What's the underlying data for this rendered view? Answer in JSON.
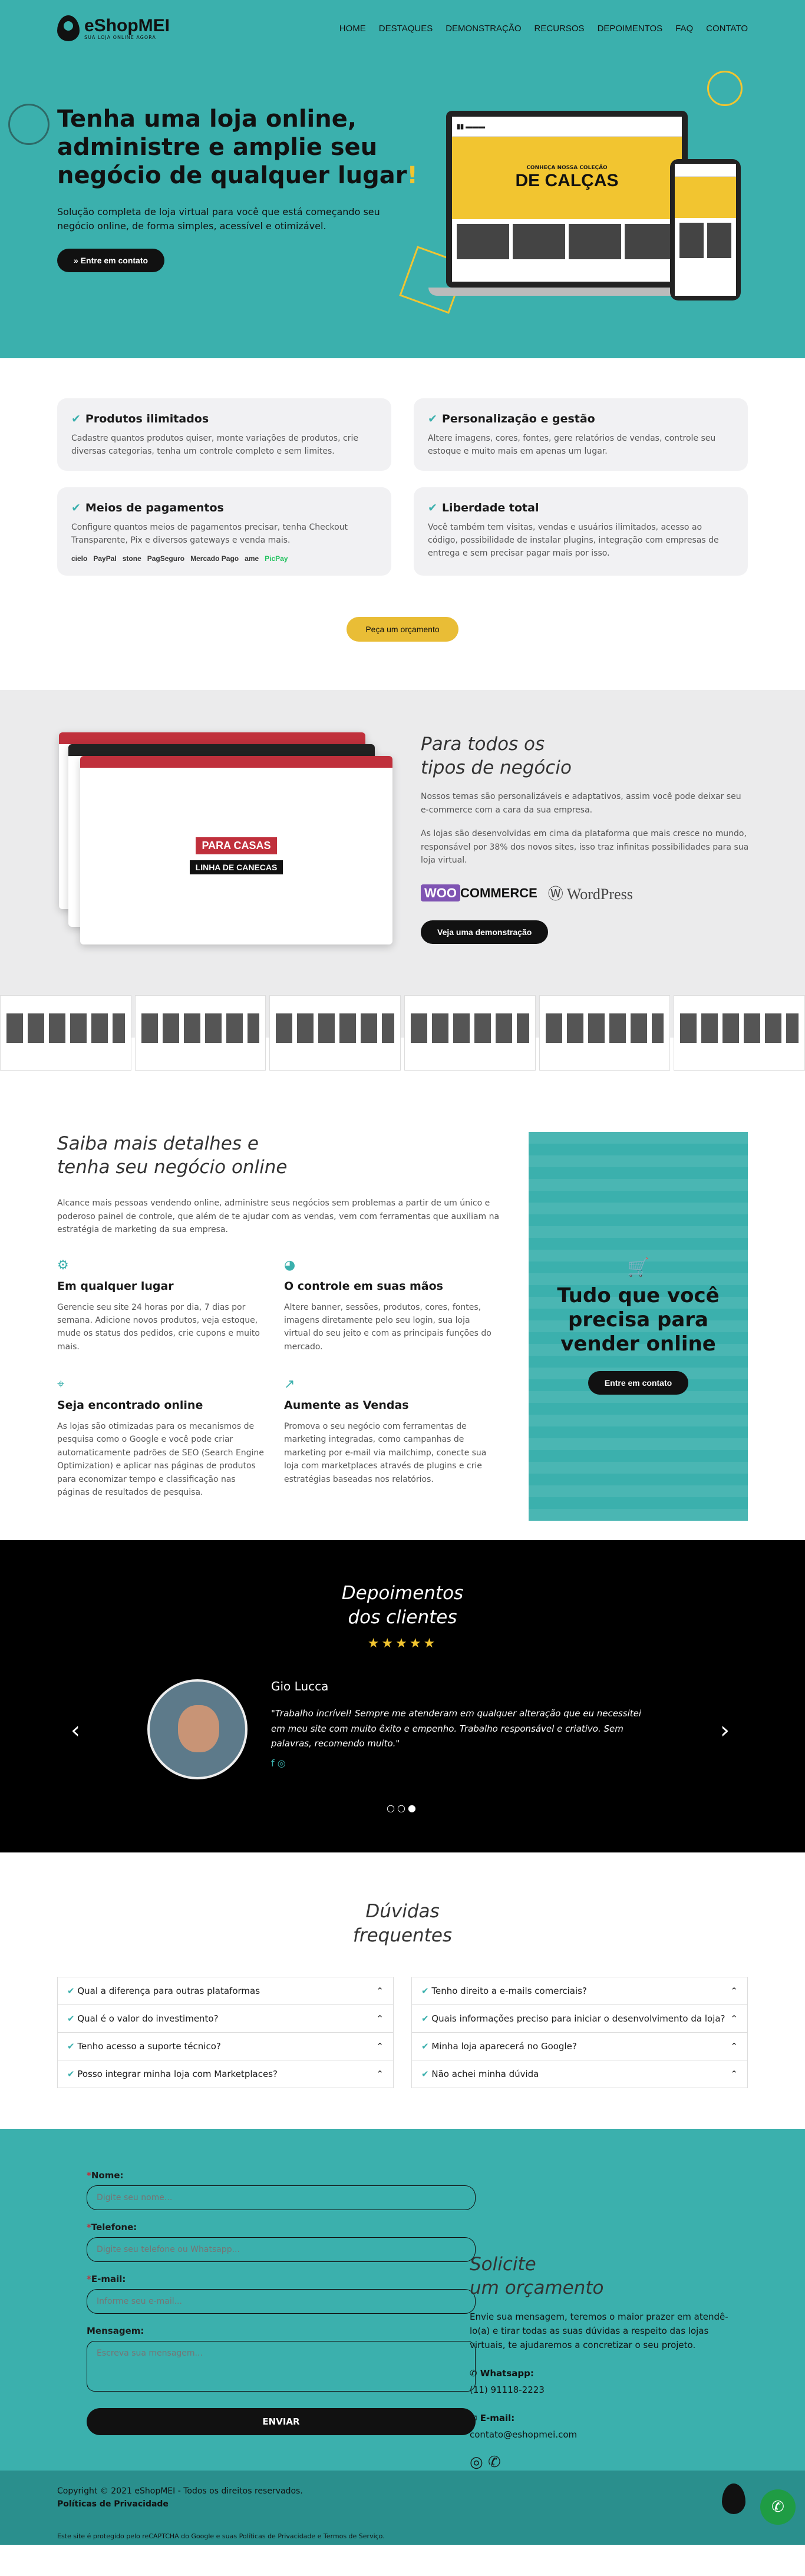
{
  "brand": {
    "name": "eShopMEI",
    "tagline": "SUA LOJA ONLINE AGORA"
  },
  "nav": [
    "HOME",
    "DESTAQUES",
    "DEMONSTRAÇÃO",
    "RECURSOS",
    "DEPOIMENTOS",
    "FAQ",
    "CONTATO"
  ],
  "hero": {
    "title": "Tenha uma loja online, administre e amplie seu negócio de qualquer lugar",
    "title_mark": "!",
    "subtitle": "Solução completa de loja virtual para você que está começando seu negócio online, de forma simples, acessível e otimizável.",
    "cta": "Entre em contato",
    "mock_banner_small": "CONHEÇA NOSSA COLEÇÃO",
    "mock_banner_big": "DE CALÇAS"
  },
  "features": [
    {
      "title": "Produtos ilimitados",
      "text": "Cadastre quantos produtos quiser, monte variações de produtos, crie diversas categorias, tenha um controle completo e sem limites."
    },
    {
      "title": "Personalização e gestão",
      "text": "Altere imagens, cores, fontes, gere relatórios de vendas, controle seu estoque e muito mais em apenas um lugar."
    },
    {
      "title": "Meios de pagamentos",
      "text": "Configure quantos meios de pagamentos precisar, tenha Checkout Transparente, Pix e diversos gateways e venda mais."
    },
    {
      "title": "Liberdade total",
      "text": "Você também tem visitas, vendas e usuários ilimitados, acesso ao código, possibilidade de instalar plugins, integração com empresas de entrega e sem precisar pagar mais por isso."
    }
  ],
  "payments": [
    "cielo",
    "PayPal",
    "stone",
    "PagSeguro",
    "Mercado Pago",
    "ame",
    "PicPay"
  ],
  "quote_button": "Peça um orçamento",
  "templates": {
    "title_1": "Para todos os",
    "title_2": "tipos de negócio",
    "p1": "Nossos temas são personalizáveis e adaptativos, assim você pode deixar seu e-commerce com a cara da sua empresa.",
    "p2": "As lojas são desenvolvidas em cima da plataforma que mais cresce no mundo, responsável por 38% dos novos sites, isso traz infinitas possibilidades para sua loja virtual.",
    "woo_1": "WOO",
    "woo_2": "COMMERCE",
    "wp": "WordPress",
    "cta": "Veja uma demonstração",
    "mock_title": "PARA CASAS",
    "mock_sub": "LINHA DE CANECAS"
  },
  "details": {
    "title_1": "Saiba mais detalhes e",
    "title_2": "tenha seu negócio online",
    "intro": "Alcance mais pessoas vendendo online, administre seus negócios sem problemas a partir de um único e poderoso painel de controle, que além de te ajudar com as vendas, vem com ferramentas que auxiliam na estratégia de marketing da sua empresa.",
    "items": [
      {
        "title": "Em qualquer lugar",
        "text": "Gerencie seu site 24 horas por dia, 7 dias por semana. Adicione novos produtos, veja estoque, mude os status dos pedidos, crie cupons e muito mais."
      },
      {
        "title": "O controle em suas mãos",
        "text": "Altere banner, sessões, produtos, cores, fontes, imagens diretamente pelo seu login, sua loja virtual do seu jeito e com as principais funções do mercado."
      },
      {
        "title": "Seja encontrado online",
        "text": "As lojas são otimizadas para os mecanismos de pesquisa como o Google e você pode criar automaticamente padrões de SEO (Search Engine Optimization) e aplicar nas páginas de produtos para economizar tempo e classificação nas páginas de resultados de pesquisa."
      },
      {
        "title": "Aumente as Vendas",
        "text": "Promova o seu negócio com ferramentas de marketing integradas, como campanhas de marketing por e-mail via mailchimp, conecte sua loja com marketplaces através de plugins e crie estratégias baseadas nos relatórios."
      }
    ],
    "panel_title": "Tudo que você precisa para vender online",
    "panel_cta": "Entre em contato"
  },
  "testimonials": {
    "title_1": "Depoimentos",
    "title_2": "dos clientes",
    "stars": "★★★★★",
    "name": "Gio Lucca",
    "quote": "\"Trabalho incrível! Sempre me atenderam em qualquer alteração que eu necessitei em meu site com muito êxito e empenho. Trabalho responsável e criativo. Sem palavras, recomendo muito.\"",
    "social": "f  ◎",
    "dots": "○○●"
  },
  "faq": {
    "title_1": "Dúvidas",
    "title_2": "frequentes",
    "left": [
      "Qual a diferença para outras plataformas",
      "Qual é o valor do investimento?",
      "Tenho acesso a suporte técnico?",
      "Posso integrar minha loja com Marketplaces?"
    ],
    "right": [
      "Tenho direito a e-mails comerciais?",
      "Quais informações preciso para iniciar o desenvolvimento da loja?",
      "Minha loja aparecerá no Google?",
      "Não achei minha dúvida"
    ]
  },
  "contact": {
    "name_label": "Nome:",
    "name_ph": "Digite seu nome...",
    "phone_label": "Telefone:",
    "phone_ph": "Digite seu telefone ou Whatsapp...",
    "email_label": "E-mail:",
    "email_ph": "Informe seu e-mail...",
    "msg_label": "Mensagem:",
    "msg_ph": "Escreva sua mensagem...",
    "send": "ENVIAR",
    "req": "*",
    "title_1": "Solicite",
    "title_2": "um orçamento",
    "text": "Envie sua mensagem, teremos o maior prazer em atendê-lo(a) e tirar todas as suas dúvidas a respeito das lojas virtuais, te ajudaremos a concretizar o seu projeto.",
    "wa_label": "Whatsapp:",
    "wa": "(11) 91118-2223",
    "email_lbl": "E-mail:",
    "email": "contato@eshopmei.com",
    "icons": "◎ ✆"
  },
  "footer": {
    "copy": "Copyright © 2021 eShopMEI - Todos os direitos reservados.",
    "policy": "Políticas de Privacidade",
    "recaptcha": "Este site é protegido pelo reCAPTCHA do Google e suas Políticas de Privacidade e Termos de Serviço.",
    "wa_icon": "✆"
  },
  "colors": {
    "teal": "#3bb0ad",
    "yellow": "#e9bd36",
    "dark": "#111111"
  }
}
